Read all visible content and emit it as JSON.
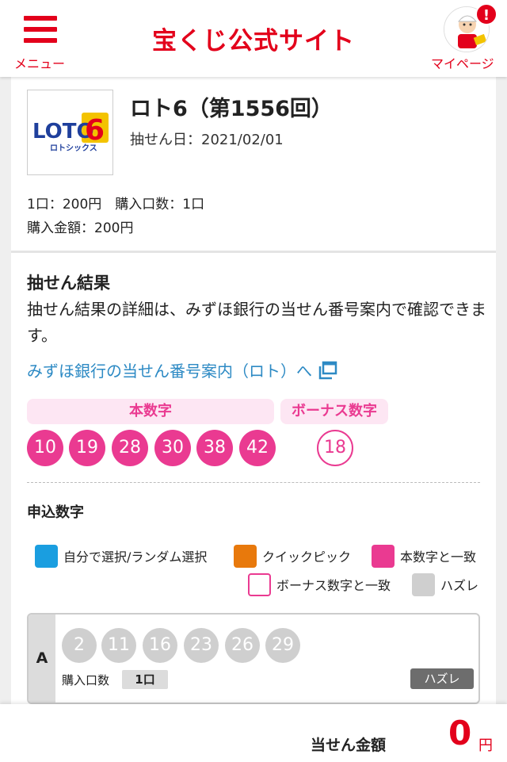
{
  "header": {
    "menu_label": "メニュー",
    "site_title": "宝くじ公式サイト",
    "mypage_label": "マイページ",
    "notification_badge": "!"
  },
  "ticket": {
    "logo_text_main": "LOTO",
    "logo_text_number": "6",
    "logo_subtext": "ロトシックス",
    "title": "ロト6（第1556回）",
    "draw_date": "抽せん日：2021/02/01",
    "unit_price": "1口：200円　購入口数：1口",
    "total_price": "購入金額：200円"
  },
  "result": {
    "heading": "抽せん結果",
    "description": "抽せん結果の詳細は、みずほ銀行の当せん番号案内で確認できます。",
    "link_text": "みずほ銀行の当せん番号案内（ロト）へ",
    "main_label": "本数字",
    "bonus_label": "ボーナス数字",
    "main_numbers": [
      "10",
      "19",
      "28",
      "30",
      "38",
      "42"
    ],
    "bonus_number": "18"
  },
  "application": {
    "heading": "申込数字",
    "legend": {
      "self_select": "自分で選択/ランダム選択",
      "quick_pick": "クイックピック",
      "main_match": "本数字と一致",
      "bonus_match": "ボーナス数字と一致",
      "miss": "ハズレ"
    },
    "entries": [
      {
        "letter": "A",
        "numbers": [
          "2",
          "11",
          "16",
          "23",
          "26",
          "29"
        ],
        "units_label": "購入口数",
        "units_value": "1口",
        "status": "ハズレ"
      }
    ]
  },
  "footer": {
    "prize_label": "当せん金額",
    "prize_value": "0",
    "prize_unit": "円"
  },
  "colors": {
    "brand_red": "#e3001b",
    "match_pink": "#ea3a91",
    "self_select_blue": "#1a9ee0",
    "quick_pick_orange": "#e8790c",
    "miss_gray": "#cfcfcf",
    "link_blue": "#2d8ac4"
  }
}
